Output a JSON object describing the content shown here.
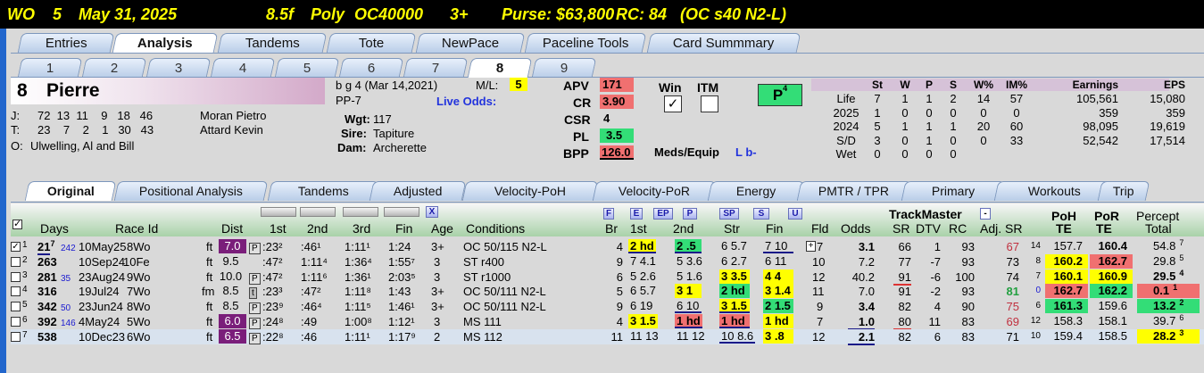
{
  "race_header": {
    "track": "WO",
    "race": "5",
    "date": "May 31, 2025",
    "distance": "8.5f",
    "surface": "Poly",
    "race_type": "OC40000",
    "age": "3+",
    "purse": "Purse: $63,800",
    "rc": "RC: 84",
    "cond": "(OC s40 N2-L)"
  },
  "main_tabs": [
    "Entries",
    "Analysis",
    "Tandems",
    "Tote",
    "NewPace",
    "Paceline Tools",
    "Card Summmary"
  ],
  "main_active": "Analysis",
  "horse_tabs": [
    "1",
    "2",
    "3",
    "4",
    "5",
    "6",
    "7",
    "8",
    "9"
  ],
  "horse_active": "8",
  "horse": {
    "program": "8",
    "name": "Pierre",
    "breeding": "b g 4 (Mar 14,2021)",
    "pp": "PP-7",
    "ml_label": "M/L:",
    "ml": "5",
    "live_odds": "Live Odds:",
    "wgt_label": "Wgt:",
    "wgt": "117",
    "sire_label": "Sire:",
    "sire": "Tapiture",
    "dam_label": "Dam:",
    "dam": "Archerette",
    "jockey_label": "J:",
    "jockey_stats": "72  13  11    9   18   46",
    "jockey": "Moran Pietro",
    "trainer_label": "T:",
    "trainer_stats": "23    7    2    1   30   43",
    "trainer": "Attard Kevin",
    "owner_label": "O:",
    "owner": "Ulwelling, Al and Bill"
  },
  "ratings": {
    "apv_label": "APV",
    "apv": "171",
    "cr_label": "CR",
    "cr": "3.90",
    "csr_label": "CSR",
    "csr": "4",
    "pl_label": "PL",
    "pl": "3.5",
    "bpp_label": "BPP",
    "bpp": "126.0",
    "win_label": "Win",
    "itm_label": "ITM",
    "win_check": "✓",
    "p_badge": "P",
    "p_badge_sup": "4",
    "meds_label": "Meds/Equip",
    "meds": "L b-"
  },
  "record": {
    "headers": [
      "St",
      "W",
      "P",
      "S",
      "W%",
      "IM%",
      "Earnings",
      "EPS"
    ],
    "rows": [
      {
        "label": "Life",
        "vals": [
          "7",
          "1",
          "1",
          "2",
          "14",
          "57",
          "105,561",
          "15,080"
        ]
      },
      {
        "label": "2025",
        "vals": [
          "1",
          "0",
          "0",
          "0",
          "0",
          "0",
          "359",
          "359"
        ]
      },
      {
        "label": "2024",
        "vals": [
          "5",
          "1",
          "1",
          "1",
          "20",
          "60",
          "98,095",
          "19,619"
        ]
      },
      {
        "label": "S/D",
        "vals": [
          "3",
          "0",
          "1",
          "0",
          "0",
          "33",
          "52,542",
          "17,514"
        ]
      },
      {
        "label": "Wet",
        "vals": [
          "0",
          "0",
          "0",
          "0",
          "",
          "",
          "",
          ""
        ]
      }
    ]
  },
  "analysis_tabs": [
    "Original",
    "Positional Analysis",
    "Tandems",
    "Adjusted",
    "Velocity-PoH",
    "Velocity-PoR",
    "Energy",
    "PMTR / TPR",
    "Primary",
    "Workouts",
    "Trip"
  ],
  "analysis_active": "Original",
  "columns": {
    "days": "Days",
    "raceid": "Race Id",
    "dist": "Dist",
    "c1": "1st",
    "c2": "2nd",
    "c3": "3rd",
    "fin": "Fin",
    "age": "Age",
    "cond": "Conditions",
    "br": "Br",
    "pc1": "1st",
    "pc2": "2nd",
    "str": "Str",
    "pfin": "Fin",
    "fld": "Fld",
    "odds": "Odds",
    "tm": "TrackMaster",
    "sr": "SR",
    "dtv": "DTV",
    "rc": "RC",
    "adjsr": "Adj. SR",
    "poh1": "PoH",
    "poh2": "TE",
    "por1": "PoR",
    "por2": "TE",
    "pct1": "Percept",
    "pct2": "Total"
  },
  "pace_flags": [
    "F",
    "E",
    "EP",
    "P",
    "SP",
    "S",
    "U"
  ],
  "x_flag": "X",
  "minus_flag": "-",
  "rows": [
    {
      "num": "1",
      "checked": "✓",
      "days": "21",
      "days_sup": "7",
      "days_sub": "242",
      "raceid": "10May25",
      "track": "8Wo",
      "surf": "ft",
      "dist": "7.0",
      "flag": "P",
      "c1": ":23²",
      "c2": ":46¹",
      "c3": "1:11¹",
      "fin": "1:24",
      "age": "3+",
      "cond": "OC 50/115 N2-L",
      "br": "4",
      "pc1": "2 hd",
      "pc2": "2 .5",
      "str": "6 5.7",
      "pfin": "7 10",
      "pfin_box": "+",
      "fld": "7",
      "odds": "3.1",
      "sr": "66",
      "dtv": "1",
      "rc": "93",
      "adjsr": "67",
      "adjsr_sup": "14",
      "poh": "157.7",
      "por": "160.4",
      "pct": "54.8",
      "pct_sup": "7"
    },
    {
      "num": "2",
      "checked": "",
      "days": "263",
      "days_sup": "",
      "days_sub": "",
      "raceid": "10Sep24",
      "track": "10Fe",
      "surf": "ft",
      "dist": "9.5",
      "flag": "",
      "c1": ":47²",
      "c2": "1:11⁴",
      "c3": "1:36⁴",
      "fin": "1:55⁷",
      "age": "3",
      "cond": "ST r400",
      "br": "9",
      "pc1": "7 4.1",
      "pc2": "5 3.6",
      "str": "6 2.7",
      "pfin": "6 11",
      "pfin_box": "",
      "fld": "10",
      "odds": "7.2",
      "sr": "77",
      "dtv": "-7",
      "rc": "93",
      "adjsr": "73",
      "adjsr_sup": "8",
      "poh": "160.2",
      "por": "162.7",
      "pct": "29.8",
      "pct_sup": "5"
    },
    {
      "num": "3",
      "checked": "",
      "days": "281",
      "days_sup": "",
      "days_sub": "35",
      "raceid": "23Aug24",
      "track": "9Wo",
      "surf": "ft",
      "dist": "10.0",
      "flag": "P",
      "c1": ":47²",
      "c2": "1:11⁶",
      "c3": "1:36¹",
      "fin": "2:03⁵",
      "age": "3",
      "cond": "ST r1000",
      "br": "6",
      "pc1": "5 2.6",
      "pc2": "5 1.6",
      "str": "3 3.5",
      "pfin": "4 4",
      "pfin_box": "",
      "fld": "12",
      "odds": "40.2",
      "sr": "91",
      "dtv": "-6",
      "rc": "100",
      "adjsr": "74",
      "adjsr_sup": "7",
      "poh": "160.1",
      "por": "160.9",
      "pct": "29.5",
      "pct_sup": "4"
    },
    {
      "num": "4",
      "checked": "",
      "days": "316",
      "days_sup": "",
      "days_sub": "",
      "raceid": "19Jul24",
      "track": "7Wo",
      "surf": "fm",
      "dist": "8.5",
      "flag": "t",
      "c1": ":23³",
      "c2": ":47²",
      "c3": "1:11⁸",
      "fin": "1:43",
      "age": "3+",
      "cond": "OC 50/111 N2-L",
      "br": "5",
      "pc1": "6 5.7",
      "pc2": "3 1",
      "str": "2 hd",
      "pfin": "3 1.4",
      "pfin_box": "",
      "fld": "11",
      "odds": "7.0",
      "sr": "91",
      "dtv": "-2",
      "rc": "93",
      "adjsr": "81",
      "adjsr_sup": "0",
      "poh": "162.7",
      "por": "162.2",
      "pct": "0.1",
      "pct_sup": "1"
    },
    {
      "num": "5",
      "checked": "",
      "days": "342",
      "days_sup": "",
      "days_sub": "50",
      "raceid": "23Jun24",
      "track": "8Wo",
      "surf": "ft",
      "dist": "8.5",
      "flag": "P",
      "c1": ":23⁹",
      "c2": ":46⁴",
      "c3": "1:11⁵",
      "fin": "1:46¹",
      "age": "3+",
      "cond": "OC 50/111 N2-L",
      "br": "9",
      "pc1": "6 19",
      "pc2": "6 10",
      "str": "3 1.5",
      "pfin": "2 1.5",
      "pfin_box": "",
      "fld": "9",
      "odds": "3.4",
      "sr": "82",
      "dtv": "4",
      "rc": "90",
      "adjsr": "75",
      "adjsr_sup": "6",
      "poh": "161.3",
      "por": "159.6",
      "pct": "13.2",
      "pct_sup": "2"
    },
    {
      "num": "6",
      "checked": "",
      "days": "392",
      "days_sup": "",
      "days_sub": "146",
      "raceid": "4May24",
      "track": "5Wo",
      "surf": "ft",
      "dist": "6.0",
      "flag": "P",
      "c1": ":24⁸",
      "c2": ":49",
      "c3": "1:00⁸",
      "fin": "1:12¹",
      "age": "3",
      "cond": "MS 111",
      "br": "4",
      "pc1": "3 1.5",
      "pc2": "1 hd",
      "str": "1 hd",
      "pfin": "1 hd",
      "pfin_box": "",
      "fld": "7",
      "odds": "1.0",
      "sr": "80",
      "dtv": "11",
      "rc": "83",
      "adjsr": "69",
      "adjsr_sup": "12",
      "poh": "158.3",
      "por": "158.1",
      "pct": "39.7",
      "pct_sup": "6"
    },
    {
      "num": "7",
      "checked": "",
      "days": "538",
      "days_sup": "",
      "days_sub": "",
      "raceid": "10Dec23",
      "track": "6Wo",
      "surf": "ft",
      "dist": "6.5",
      "flag": "P",
      "c1": ":22⁸",
      "c2": ":46",
      "c3": "1:11¹",
      "fin": "1:17⁹",
      "age": "2",
      "cond": "MS 112",
      "br": "11",
      "pc1": "11 13",
      "pc2": "11 12",
      "str": "10 8.6",
      "pfin": "3 .8",
      "pfin_box": "",
      "fld": "12",
      "odds": "2.1",
      "sr": "82",
      "dtv": "6",
      "rc": "83",
      "adjsr": "71",
      "adjsr_sup": "10",
      "poh": "159.4",
      "por": "158.5",
      "pct": "28.2",
      "pct_sup": "3"
    }
  ]
}
